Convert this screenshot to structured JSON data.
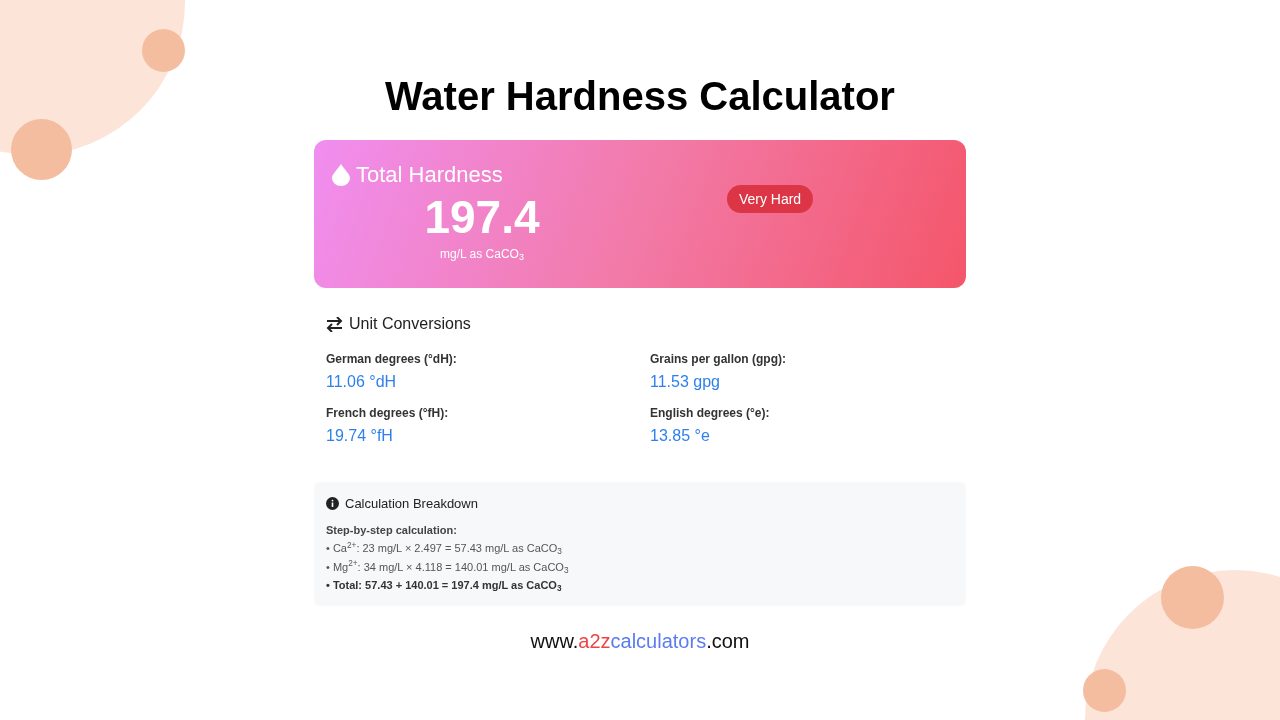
{
  "title": "Water Hardness Calculator",
  "result": {
    "heading": "Total Hardness",
    "value": "197.4",
    "unit": "mg/L as CaCO$_{3}$",
    "category": "Very Hard"
  },
  "conversions": {
    "heading": "Unit Conversions",
    "items": [
      {
        "label": "German degrees (°dH):",
        "value": "11.06 °dH"
      },
      {
        "label": "Grains per gallon (gpg):",
        "value": "11.53 gpg"
      },
      {
        "label": "French degrees (°fH):",
        "value": "19.74 °fH"
      },
      {
        "label": "English degrees (°e):",
        "value": "13.85 °e"
      }
    ]
  },
  "breakdown": {
    "heading": "Calculation Breakdown",
    "subheading": "Step-by-step calculation:",
    "steps": [
      {
        "text": "• Ca$^{2+}$: 23 mg/L × 2.497 = 57.43 mg/L as CaCO$_{3}$",
        "kind": "step"
      },
      {
        "text": "• Mg$^{2+}$: 34 mg/L × 4.118 = 140.01 mg/L as CaCO$_{3}$",
        "kind": "step"
      },
      {
        "text": "• Total: 57.43 + 140.01 = 197.4 mg/L as CaCO$_{3}$",
        "kind": "total"
      }
    ]
  },
  "site": [
    {
      "text": "www.",
      "color": "#111111"
    },
    {
      "text": "a2z",
      "color": "#ef4444"
    },
    {
      "text": "calculators",
      "color": "#5b7cf0"
    },
    {
      "text": ".com",
      "color": "#111111"
    }
  ]
}
